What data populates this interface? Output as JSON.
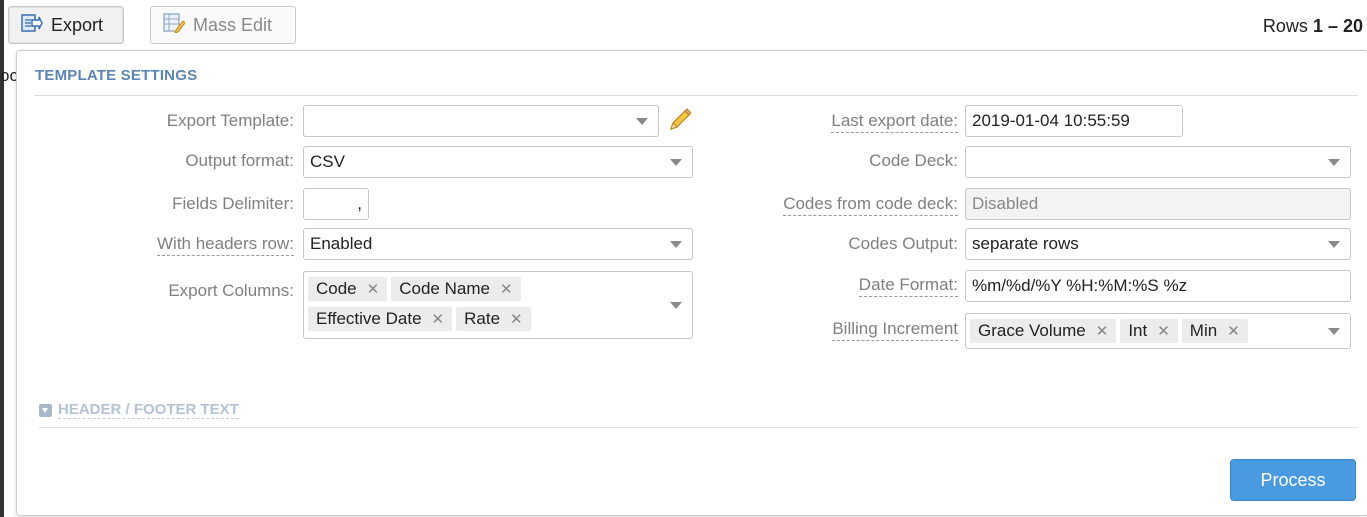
{
  "toolbar": {
    "export_label": "Export",
    "mass_edit_label": "Mass Edit",
    "rows_prefix": "Rows",
    "rows_range": "1 – 20",
    "cutoff_text": "oc"
  },
  "template_settings": {
    "title": "TEMPLATE SETTINGS",
    "export_template": {
      "label": "Export Template:",
      "value": ""
    },
    "output_format": {
      "label": "Output format:",
      "value": "CSV"
    },
    "fields_delimiter": {
      "label": "Fields Delimiter:",
      "value": ","
    },
    "with_headers_row": {
      "label": "With headers row:",
      "value": "Enabled"
    },
    "export_columns": {
      "label": "Export Columns:",
      "tags": [
        "Code",
        "Code Name",
        "Effective Date",
        "Rate"
      ]
    },
    "last_export_date": {
      "label": "Last export date:",
      "value": "2019-01-04 10:55:59"
    },
    "code_deck": {
      "label": "Code Deck:",
      "value": ""
    },
    "codes_from_code_deck": {
      "label": "Codes from code deck:",
      "value": "Disabled"
    },
    "codes_output": {
      "label": "Codes Output:",
      "value": "separate rows"
    },
    "date_format": {
      "label": "Date Format:",
      "value": "%m/%d/%Y %H:%M:%S %z"
    },
    "billing_increment": {
      "label": "Billing Increment",
      "tags": [
        "Grace Volume",
        "Int",
        "Min"
      ]
    }
  },
  "header_footer": {
    "title": "HEADER / FOOTER TEXT"
  },
  "actions": {
    "process_label": "Process"
  },
  "colors": {
    "accent": "#4a9ae0",
    "section_title": "#5b86b5"
  },
  "icons": {
    "export": "export-icon",
    "mass_edit": "mass-edit-icon",
    "pencil": "pencil-icon"
  }
}
